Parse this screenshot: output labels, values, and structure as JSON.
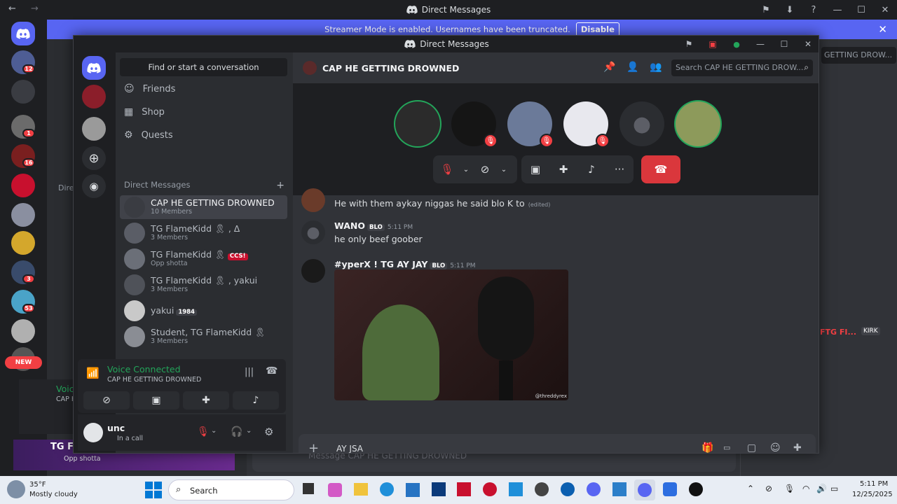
{
  "outer_window": {
    "title": "Direct Messages",
    "streamer_banner": "Streamer Mode is enabled. Usernames have been truncated.",
    "streamer_disable": "Disable",
    "badges": [
      "12",
      "1",
      "16",
      "3",
      "53"
    ],
    "new_label": "NEW",
    "bg_voice_connected": "Voice Co",
    "bg_voice_channel": "CAP HE GE",
    "bg_dm_name": "TG Flam",
    "bg_dm_status": "Opp shotta",
    "bg_search": "GETTING DROW...",
    "bg_header_partial": "Dire",
    "bg_composer_placeholder": "Message CAP HE GETTING DROWNED",
    "bg_member_tag": "KIRK",
    "bg_member_name": "FTG FI..."
  },
  "inner_window": {
    "title": "Direct Messages"
  },
  "sidebar": {
    "find_placeholder": "Find or start a conversation",
    "nav": [
      {
        "label": "Friends",
        "icon": "friends-icon"
      },
      {
        "label": "Shop",
        "icon": "shop-icon"
      },
      {
        "label": "Quests",
        "icon": "quests-icon"
      }
    ],
    "dm_header": "Direct Messages",
    "dm_add": "+",
    "dms": [
      {
        "name": "CAP HE GETTING DROWNED",
        "sub": "10 Members",
        "active": true
      },
      {
        "name": "TG FlameKidd 🎗 , Δ",
        "sub": "3 Members"
      },
      {
        "name": "TG FlameKidd 🎗",
        "tag": "CCS!",
        "sub": "Opp shotta"
      },
      {
        "name": "TG FlameKidd 🎗 , yakui",
        "sub": "3 Members"
      },
      {
        "name": "yakui",
        "tag": "1984",
        "sub": ""
      },
      {
        "name": "Student, TG FlameKidd 🎗",
        "sub": "3 Members"
      }
    ]
  },
  "voice_panel": {
    "status": "Voice Connected",
    "channel": "CAP HE GETTING DROWNED"
  },
  "user_panel": {
    "name": "unc",
    "status": "In a call"
  },
  "chat": {
    "channel_name": "CAP HE GETTING DROWNED",
    "search_placeholder": "Search CAP HE GETTING DROW...",
    "messages": [
      {
        "author": "",
        "text": "He with them aykay niggas he said blo K to",
        "edited": "(edited)"
      },
      {
        "author": "WANO",
        "tag": "BLO",
        "time": "5:11 PM",
        "text": "he only beef goober"
      },
      {
        "author": "#yperX ! TG AY JAY",
        "tag": "BLO",
        "time": "5:11 PM",
        "text": "",
        "image_caption": "@threddyrex"
      }
    ],
    "composer_value": "AY JSA"
  },
  "taskbar": {
    "weather_temp": "35°F",
    "weather_desc": "Mostly cloudy",
    "search_label": "Search",
    "time": "5:11 PM",
    "date": "12/25/2025"
  },
  "colors": {
    "brand": "#5865f2",
    "green": "#23a55a",
    "red": "#f23f43",
    "end_call": "#da373c"
  }
}
